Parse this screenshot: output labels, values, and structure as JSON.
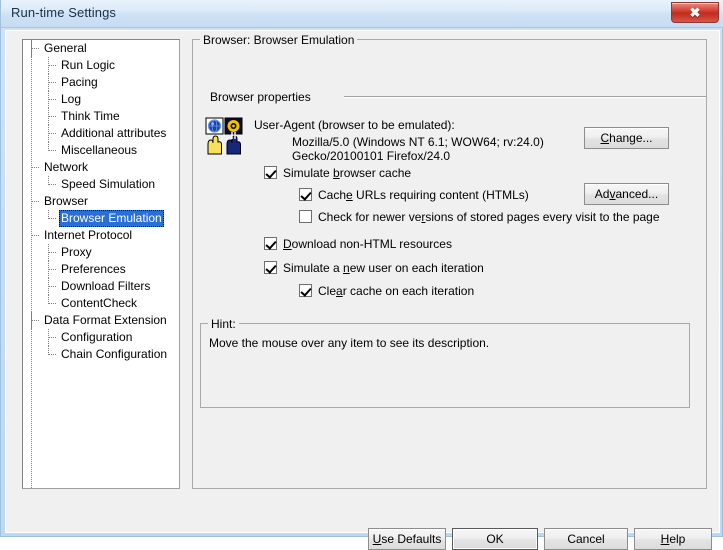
{
  "window": {
    "title": "Run-time Settings",
    "close_label": "✖",
    "close_icon": "close-icon"
  },
  "tree": {
    "items": [
      {
        "label": "General",
        "level": 0,
        "selected": false
      },
      {
        "label": "Run Logic",
        "level": 1,
        "selected": false
      },
      {
        "label": "Pacing",
        "level": 1,
        "selected": false
      },
      {
        "label": "Log",
        "level": 1,
        "selected": false
      },
      {
        "label": "Think Time",
        "level": 1,
        "selected": false
      },
      {
        "label": "Additional attributes",
        "level": 1,
        "selected": false
      },
      {
        "label": "Miscellaneous",
        "level": 1,
        "selected": false
      },
      {
        "label": "Network",
        "level": 0,
        "selected": false
      },
      {
        "label": "Speed Simulation",
        "level": 1,
        "selected": false
      },
      {
        "label": "Browser",
        "level": 0,
        "selected": false
      },
      {
        "label": "Browser Emulation",
        "level": 1,
        "selected": true
      },
      {
        "label": "Internet Protocol",
        "level": 0,
        "selected": false
      },
      {
        "label": "Proxy",
        "level": 1,
        "selected": false
      },
      {
        "label": "Preferences",
        "level": 1,
        "selected": false
      },
      {
        "label": "Download Filters",
        "level": 1,
        "selected": false
      },
      {
        "label": "ContentCheck",
        "level": 1,
        "selected": false
      },
      {
        "label": "Data Format Extension",
        "level": 0,
        "selected": false
      },
      {
        "label": "Configuration",
        "level": 1,
        "selected": false
      },
      {
        "label": "Chain Configuration",
        "level": 1,
        "selected": false
      }
    ]
  },
  "main": {
    "group_legend": "Browser: Browser Emulation",
    "section_label": "Browser properties",
    "icon_name": "browser-emulation-icon",
    "user_agent": {
      "label": "User-Agent (browser to be emulated):",
      "line1": "Mozilla/5.0 (Windows NT 6.1; WOW64; rv:24.0)",
      "line2": "Gecko/20100101 Firefox/24.0"
    },
    "change_button": "Change...",
    "advanced_button": "Advanced...",
    "checkboxes": [
      {
        "label": "Simulate browser cache",
        "checked": true
      },
      {
        "label": "Cache URLs requiring content (HTMLs)",
        "checked": true
      },
      {
        "label": "Check for newer versions of stored pages every visit to the page",
        "checked": false
      },
      {
        "label": "Download non-HTML resources",
        "checked": true
      },
      {
        "label": "Simulate a new user on each iteration",
        "checked": true
      },
      {
        "label": "Clear cache on each iteration",
        "checked": true
      }
    ]
  },
  "hint": {
    "legend": "Hint:",
    "text": "Move the mouse over any item to see its description."
  },
  "footer": {
    "use_defaults": "Use Defaults",
    "ok": "OK",
    "cancel": "Cancel",
    "help": "Help"
  },
  "colors": {
    "selection": "#2a6fd6",
    "titlebar": "#cfe2f5",
    "close_button": "#c32a1c",
    "dialog_face": "#f0f0f0"
  }
}
